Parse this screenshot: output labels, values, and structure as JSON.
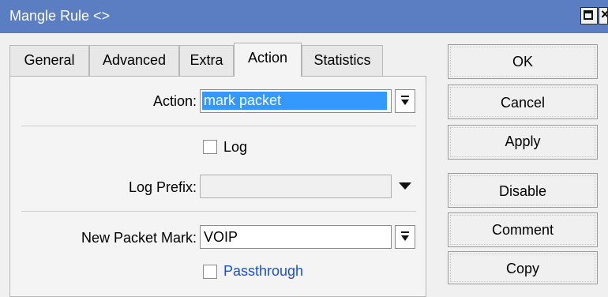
{
  "window": {
    "title": "Mangle Rule <>",
    "close_glyph": "×"
  },
  "tabs": [
    "General",
    "Advanced",
    "Extra",
    "Action",
    "Statistics"
  ],
  "active_tab": "Action",
  "form": {
    "action_label": "Action:",
    "action_value": "mark packet",
    "log_label": "Log",
    "log_checked": false,
    "log_prefix_label": "Log Prefix:",
    "log_prefix_value": "",
    "new_packet_mark_label": "New Packet Mark:",
    "new_packet_mark_value": "VOIP",
    "passthrough_label": "Passthrough",
    "passthrough_checked": false
  },
  "buttons": {
    "ok": "OK",
    "cancel": "Cancel",
    "apply": "Apply",
    "disable": "Disable",
    "comment": "Comment",
    "copy": "Copy"
  },
  "colors": {
    "titlebar": "#5b7dc2",
    "selection": "#3399ff",
    "passthrough_text": "#1a4fd6"
  }
}
